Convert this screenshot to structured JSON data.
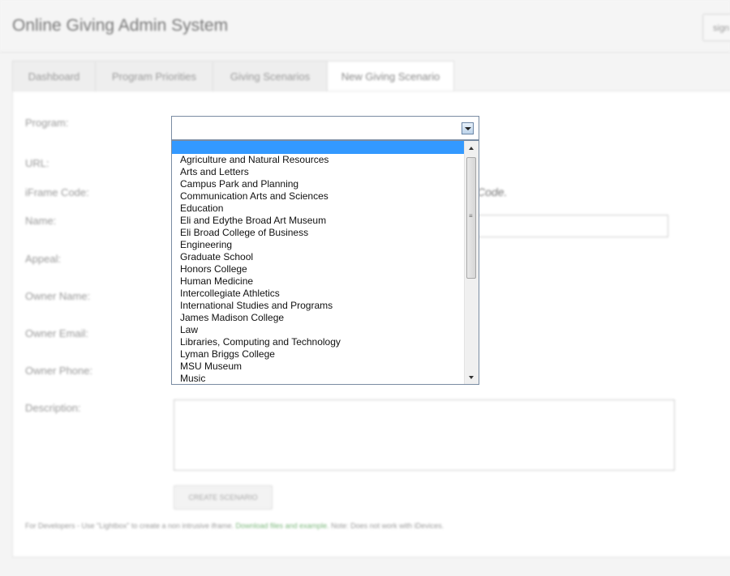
{
  "app": {
    "title": "Online Giving Admin System",
    "top_button_label": "sign"
  },
  "tabs": [
    {
      "label": "Dashboard"
    },
    {
      "label": "Program Priorities"
    },
    {
      "label": "Giving Scenarios"
    },
    {
      "label": "New Giving Scenario"
    }
  ],
  "form": {
    "program_label": "Program:",
    "url_label": "URL:",
    "iframe_label": "iFrame Code:",
    "iframe_tail": "Code.",
    "name_label": "Name:",
    "appeal_label": "Appeal:",
    "owner_name_label": "Owner Name:",
    "owner_email_label": "Owner Email:",
    "owner_phone_label": "Owner Phone:",
    "description_label": "Description:",
    "create_button": "CREATE SCENARIO"
  },
  "developer_note": {
    "prefix": "For Developers - Use \"Lightbox\" to create a non intrusive iframe.",
    "link": "Download files and example.",
    "suffix": "Note: Does not work with iDevices."
  },
  "program_select": {
    "selected_value": "",
    "options": [
      "",
      "Agriculture and Natural Resources",
      "Arts and Letters",
      "Campus Park and Planning",
      "Communication Arts and Sciences",
      "Education",
      "Eli and Edythe Broad Art Museum",
      "Eli Broad College of Business",
      "Engineering",
      "Graduate School",
      "Honors College",
      "Human Medicine",
      "Intercollegiate Athletics",
      "International Studies and Programs",
      "James Madison College",
      "Law",
      "Libraries, Computing and Technology",
      "Lyman Briggs College",
      "MSU Museum",
      "Music"
    ],
    "highlight_color": "#3399ff"
  },
  "icons": {
    "select_arrow": "chevron-down-icon",
    "scroll_up": "arrow-up-icon",
    "scroll_down": "arrow-down-icon"
  }
}
